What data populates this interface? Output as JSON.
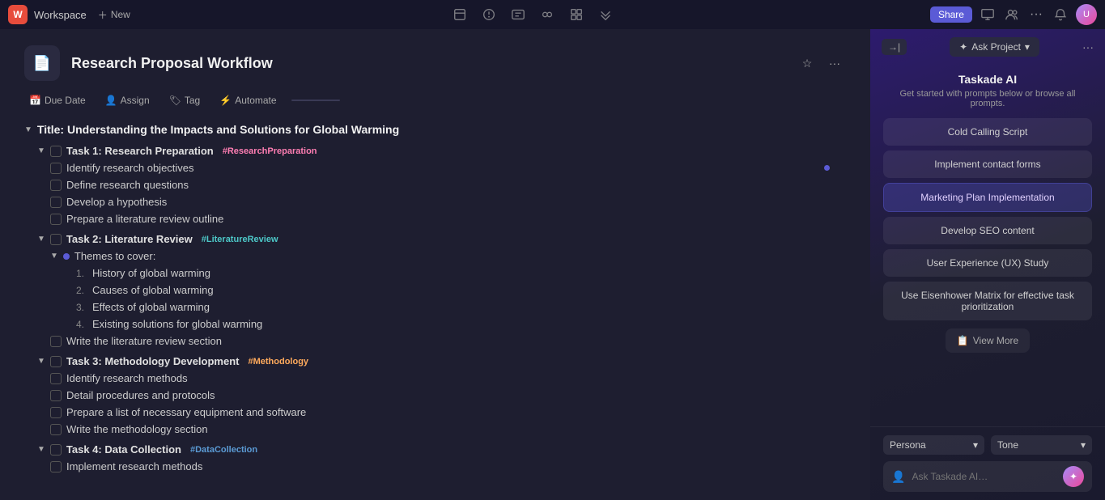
{
  "topnav": {
    "workspace_label": "Workspace",
    "new_label": "New",
    "share_label": "Share",
    "avatar_initials": "U"
  },
  "project": {
    "icon": "📄",
    "title": "Research Proposal Workflow",
    "due_date_label": "Due Date",
    "assign_label": "Assign",
    "tag_label": "Tag",
    "automate_label": "Automate"
  },
  "content": {
    "section_title": "Title: Understanding the Impacts and Solutions for Global Warming",
    "tasks": [
      {
        "id": "task1",
        "label": "Task 1: Research Preparation",
        "tag": "#ResearchPreparation",
        "tag_color": "pink",
        "subtasks": [
          "Identify research objectives",
          "Define research questions",
          "Develop a hypothesis",
          "Prepare a literature review outline"
        ]
      },
      {
        "id": "task2",
        "label": "Task 2: Literature Review",
        "tag": "#LiteratureReview",
        "tag_color": "teal",
        "themes_label": "Themes to cover:",
        "themes": [
          "History of global warming",
          "Causes of global warming",
          "Effects of global warming",
          "Existing solutions for global warming"
        ],
        "extra_subtask": "Write the literature review section"
      },
      {
        "id": "task3",
        "label": "Task 3: Methodology Development",
        "tag": "#Methodology",
        "tag_color": "orange",
        "subtasks": [
          "Identify research methods",
          "Detail procedures and protocols",
          "Prepare a list of necessary equipment and software",
          "Write the methodology section"
        ]
      },
      {
        "id": "task4",
        "label": "Task 4: Data Collection",
        "tag": "#DataCollection",
        "tag_color": "blue",
        "subtasks": [
          "Implement research methods"
        ]
      }
    ]
  },
  "ai_panel": {
    "title": "Taskade AI",
    "subtitle": "Get started with prompts below or browse all prompts.",
    "collapse_label": "→|",
    "ask_project_label": "Ask Project",
    "three_dots": "···",
    "prompts": [
      "Cold Calling Script",
      "Implement contact forms",
      "Marketing Plan Implementation",
      "Develop SEO content",
      "User Experience (UX) Study",
      "Use Eisenhower Matrix for effective task prioritization"
    ],
    "view_more_label": "View More",
    "persona_label": "Persona",
    "tone_label": "Tone",
    "input_placeholder": "Ask Taskade AI…",
    "send_icon": "✦"
  }
}
